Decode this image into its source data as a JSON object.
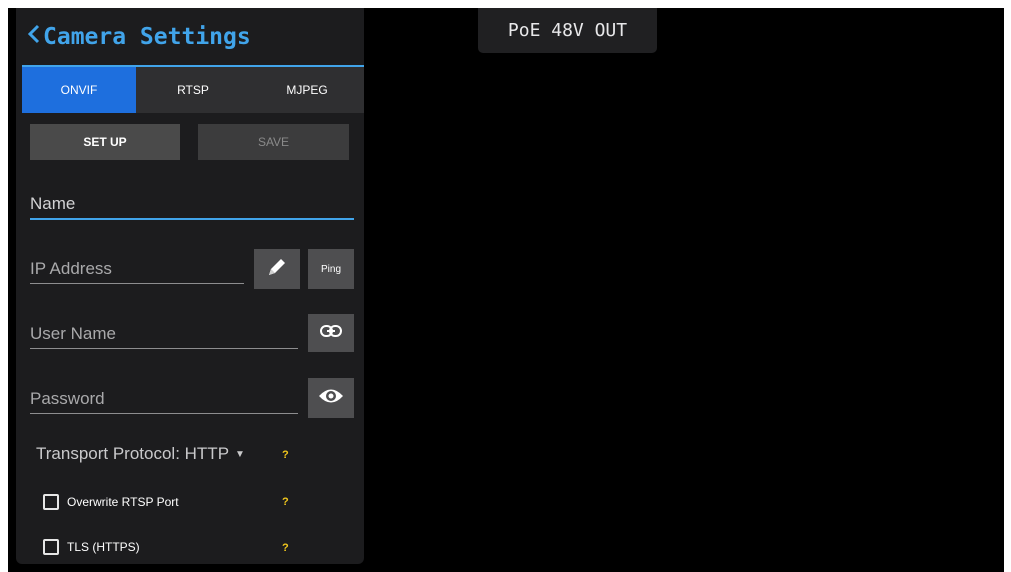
{
  "header": {
    "title": "Camera Settings",
    "back_icon": "chevron-left-icon"
  },
  "tabs": [
    {
      "label": "ONVIF",
      "active": true
    },
    {
      "label": "RTSP",
      "active": false
    },
    {
      "label": "MJPEG",
      "active": false
    }
  ],
  "actions": {
    "setup_label": "SET UP",
    "save_label": "SAVE"
  },
  "fields": {
    "name": {
      "placeholder": "Name",
      "value": ""
    },
    "ip": {
      "placeholder": "IP Address",
      "value": ""
    },
    "user": {
      "placeholder": "User Name",
      "value": ""
    },
    "password": {
      "placeholder": "Password",
      "value": ""
    }
  },
  "buttons": {
    "ping_label": "Ping",
    "edit_icon": "pencil-icon",
    "link_icon": "link-icon",
    "eye_icon": "eye-icon"
  },
  "transport": {
    "label": "Transport Protocol: HTTP",
    "help": "?"
  },
  "options": [
    {
      "label": "Overwrite RTSP Port",
      "checked": false,
      "help": "?"
    },
    {
      "label": "TLS (HTTPS)",
      "checked": false,
      "help": "?"
    }
  ],
  "status": {
    "poe": "PoE 48V OUT"
  },
  "colors": {
    "accent": "#41a4ea",
    "tab_active": "#1e6fde",
    "help": "#f2c81d",
    "panel": "#1c1c1e"
  }
}
